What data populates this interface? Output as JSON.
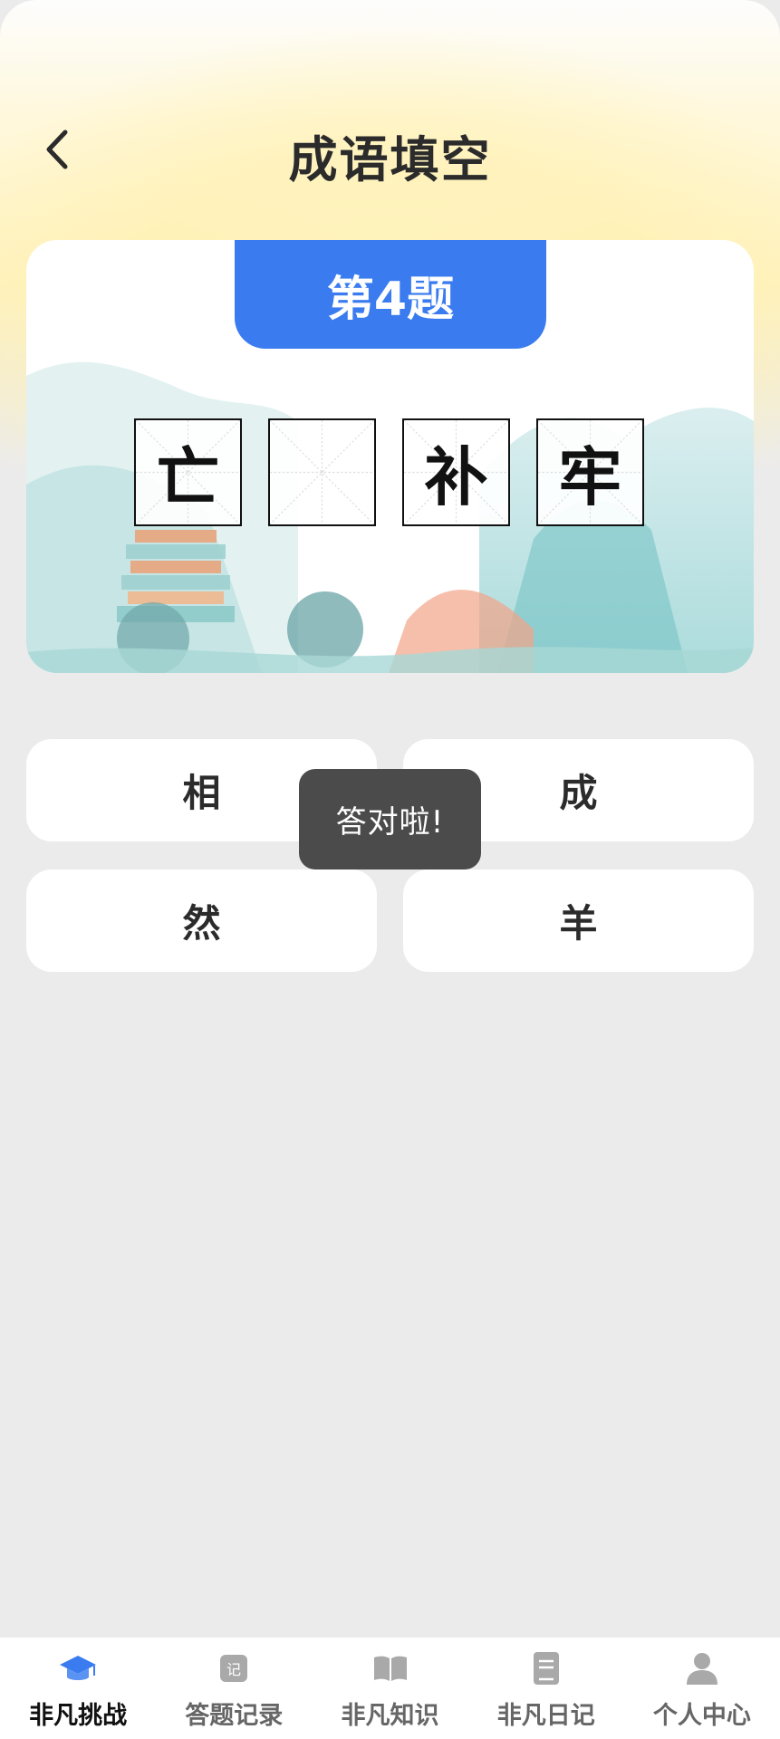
{
  "header": {
    "title": "成语填空"
  },
  "question": {
    "number_label": "第4题",
    "chars": [
      "亡",
      "",
      "补",
      "牢"
    ]
  },
  "options": [
    "相",
    "成",
    "然",
    "羊"
  ],
  "toast": {
    "message": "答对啦!"
  },
  "tabbar": {
    "items": [
      {
        "label": "非凡挑战",
        "icon": "graduation-cap-icon",
        "active": true
      },
      {
        "label": "答题记录",
        "icon": "record-icon",
        "active": false
      },
      {
        "label": "非凡知识",
        "icon": "open-book-icon",
        "active": false
      },
      {
        "label": "非凡日记",
        "icon": "diary-icon",
        "active": false
      },
      {
        "label": "个人中心",
        "icon": "person-icon",
        "active": false
      }
    ]
  },
  "colors": {
    "accent": "#3a7cf0",
    "toast_bg": "#4b4b4b",
    "background": "#ebebeb"
  }
}
